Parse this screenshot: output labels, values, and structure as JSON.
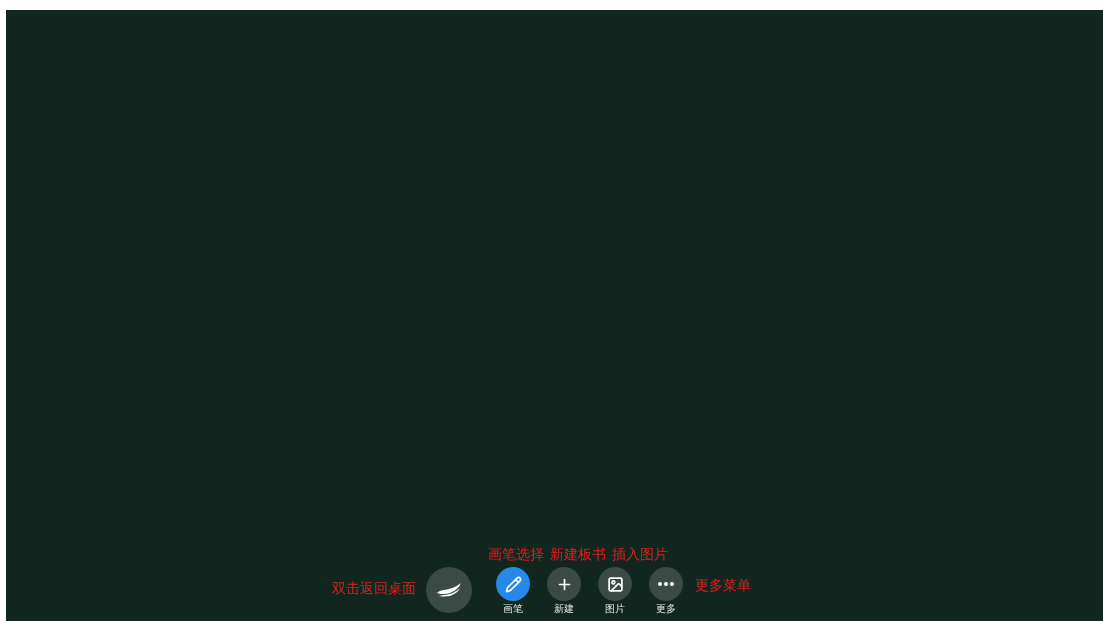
{
  "annotations_top": [
    "画笔选择",
    "新建板书",
    "插入图片"
  ],
  "annotation_left": "双击返回桌面",
  "home_button": {
    "kind": "logo"
  },
  "tools": [
    {
      "kind": "pen",
      "label": "画笔",
      "selected": true
    },
    {
      "kind": "plus",
      "label": "新建",
      "selected": false
    },
    {
      "kind": "image",
      "label": "图片",
      "selected": false
    },
    {
      "kind": "more",
      "label": "更多",
      "selected": false
    }
  ],
  "annotation_right": "更多菜单"
}
